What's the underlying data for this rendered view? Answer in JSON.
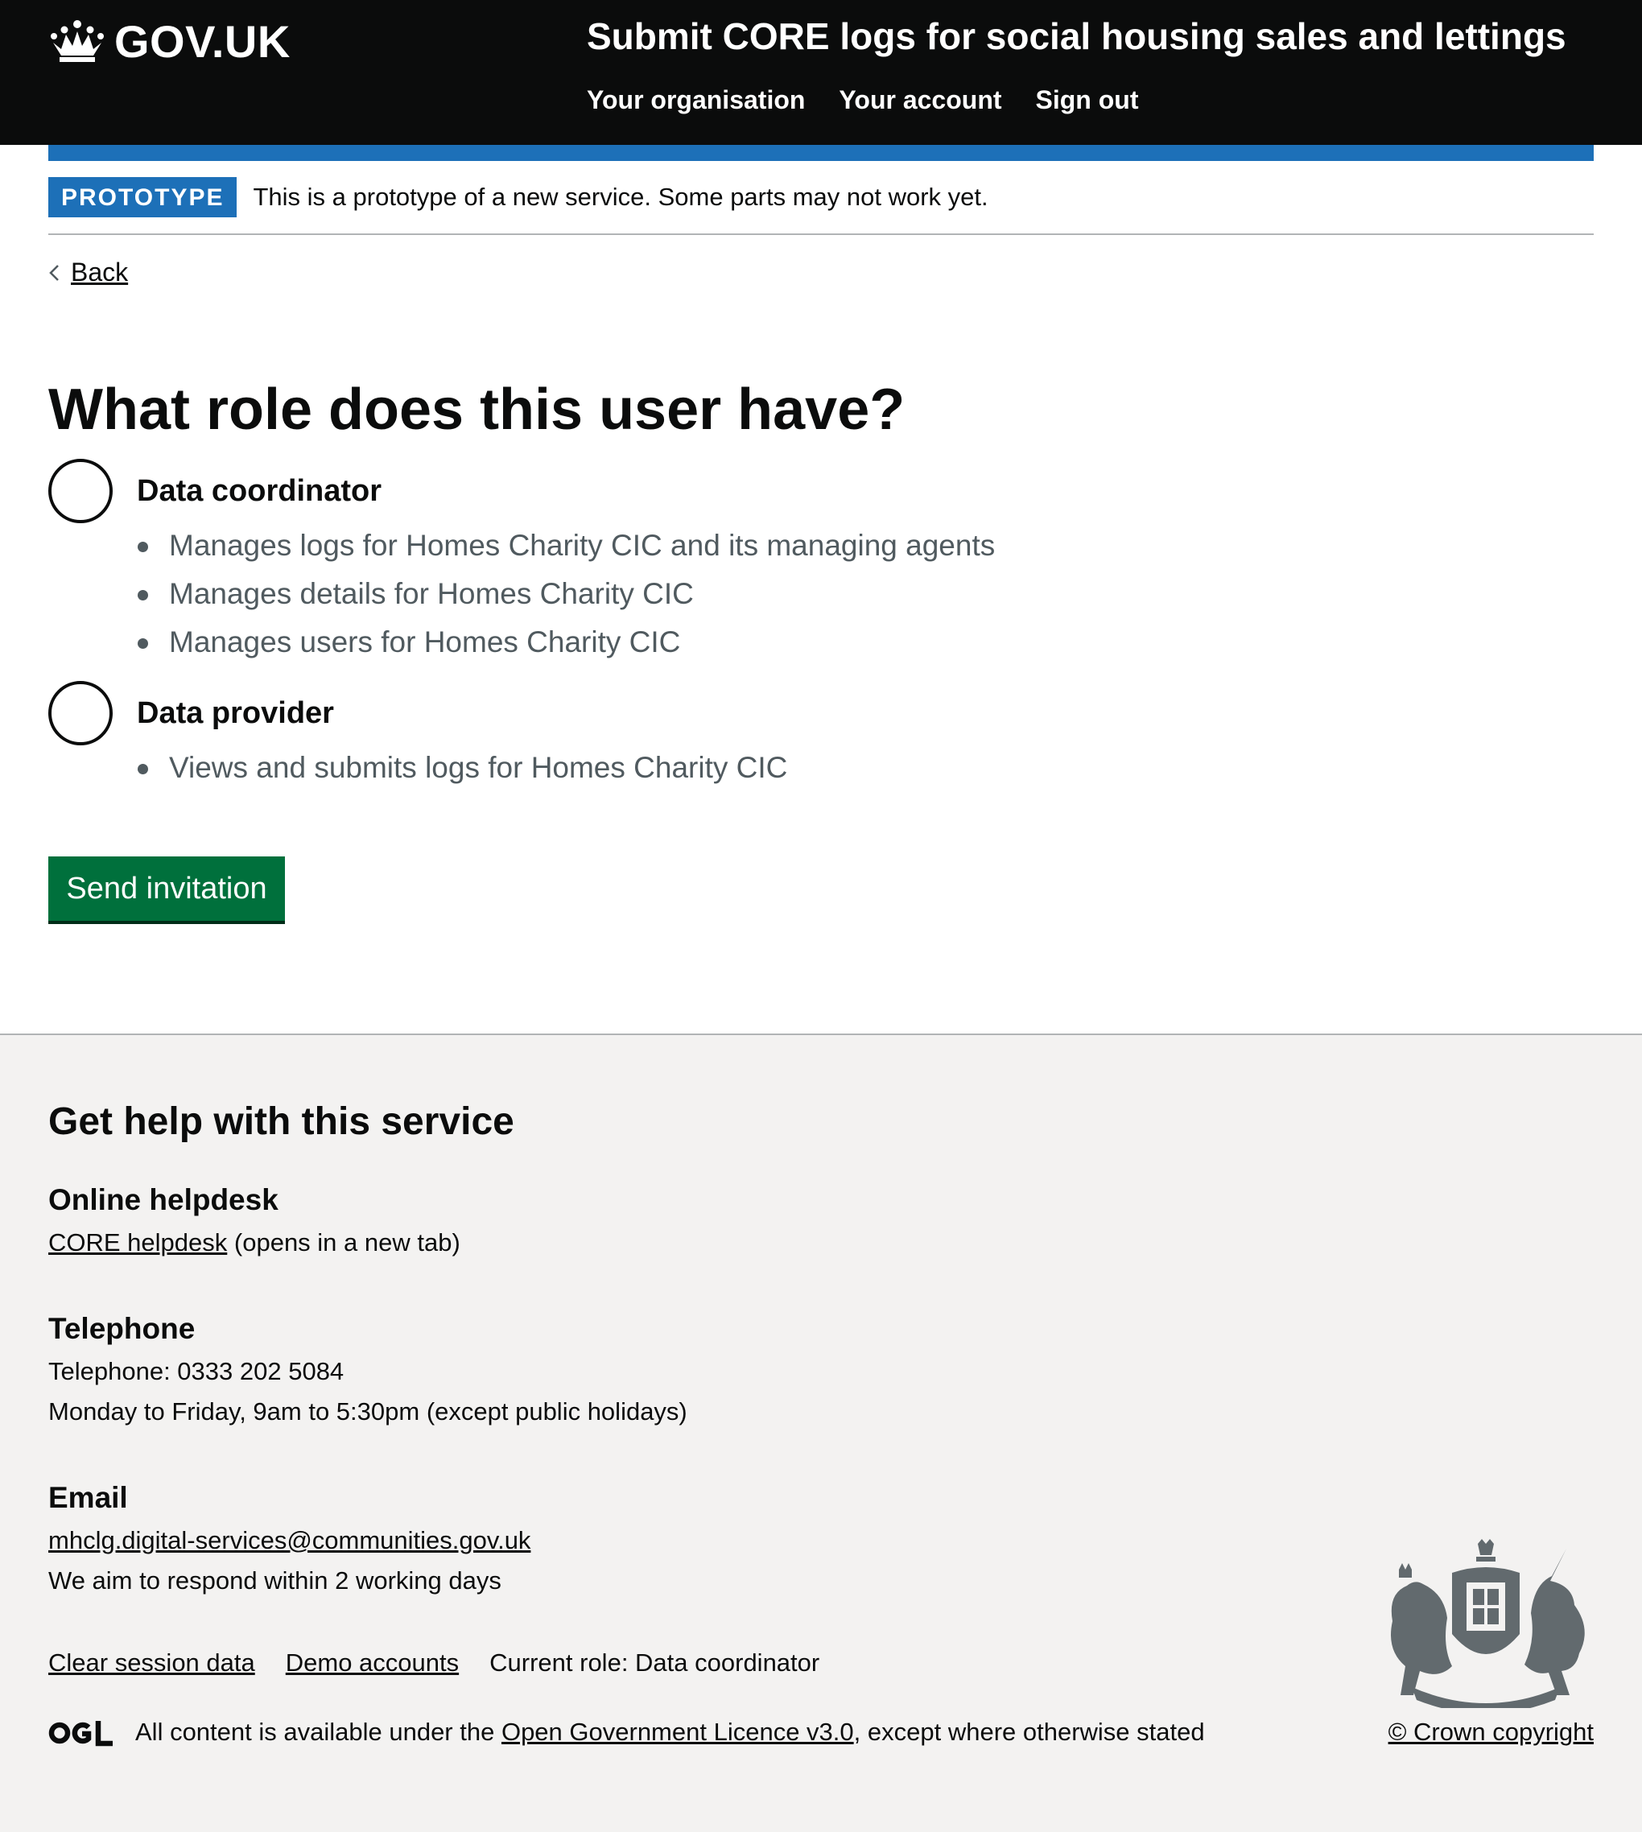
{
  "header": {
    "logo_text": "GOV.UK",
    "service_name": "Submit CORE logs for social housing sales and lettings",
    "nav": [
      "Your organisation",
      "Your account",
      "Sign out"
    ]
  },
  "phase_banner": {
    "tag": "PROTOTYPE",
    "text": "This is a prototype of a new service. Some parts may not work yet."
  },
  "back_link": "Back",
  "question": {
    "title": "What role does this user have?",
    "options": [
      {
        "label": "Data coordinator",
        "selected": false,
        "hints": [
          "Manages logs for Homes Charity CIC and its managing agents",
          "Manages details for Homes Charity CIC",
          "Manages users for Homes Charity CIC"
        ]
      },
      {
        "label": "Data provider",
        "selected": false,
        "hints": [
          "Views and submits logs for Homes Charity CIC"
        ]
      }
    ]
  },
  "submit_label": "Send invitation",
  "footer": {
    "help_title": "Get help with this service",
    "helpdesk_heading": "Online helpdesk",
    "helpdesk_link": "CORE helpdesk",
    "helpdesk_suffix": " (opens in a new tab)",
    "telephone_heading": "Telephone",
    "telephone_number": "Telephone: 0333 202 5084",
    "telephone_hours": "Monday to Friday, 9am to 5:30pm (except public holidays)",
    "email_heading": "Email",
    "email_address": "mhclg.digital-services@communities.gov.uk",
    "email_response": "We aim to respond within 2 working days",
    "clear_session": "Clear session data",
    "demo_accounts": "Demo accounts",
    "current_role": "Current role: Data coordinator",
    "licence_prefix": "All content is available under the ",
    "licence_link": "Open Government Licence v3.0",
    "licence_suffix": ", except where otherwise stated",
    "copyright": "© Crown copyright"
  },
  "colors": {
    "header_bg": "#0b0c0c",
    "brand_blue": "#1d70b8",
    "button_green": "#00703c",
    "footer_bg": "#f3f2f1",
    "hint_grey": "#505a5f"
  },
  "icons": [
    "crown-icon",
    "chevron-left-icon",
    "ogl-logo",
    "royal-coat-of-arms-icon"
  ]
}
